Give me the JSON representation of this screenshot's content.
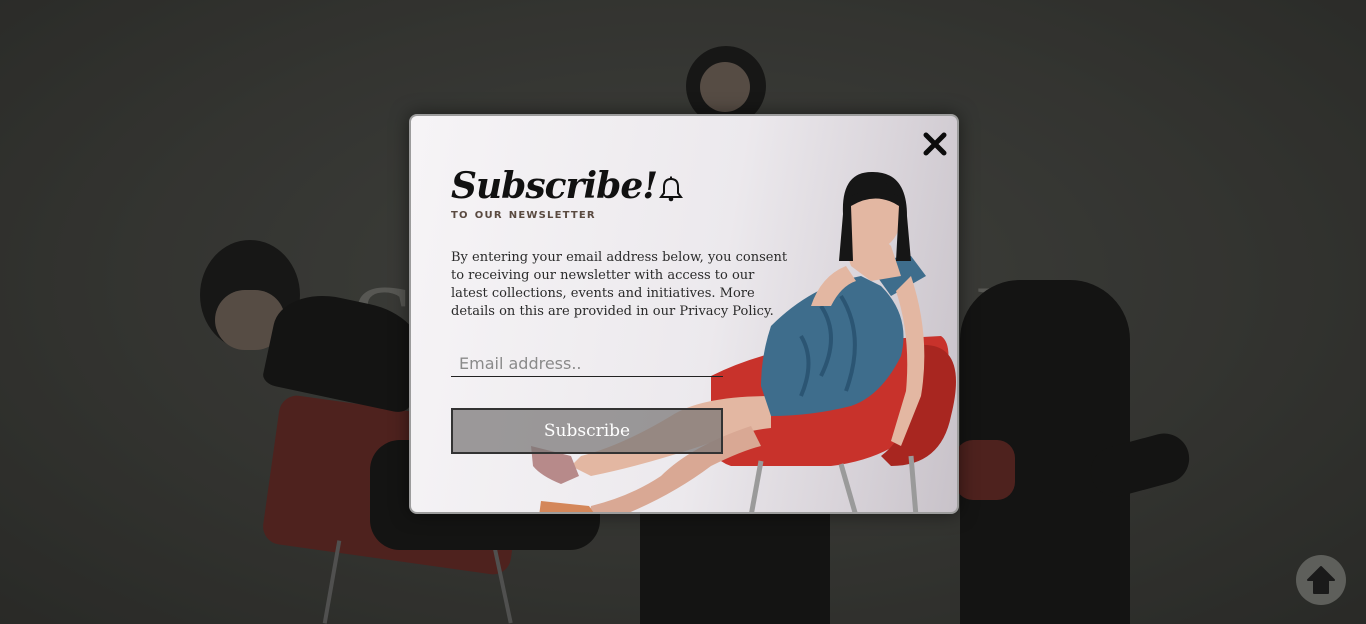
{
  "background": {
    "brand_word_left": "S",
    "brand_word_right": "I"
  },
  "modal": {
    "title": "Subscribe!",
    "subtitle": "to our newsletter",
    "description": "By entering your email address below, you consent to receiving our newsletter with access to our latest collections, events and initiatives. More details on this are provided in our Privacy Policy.",
    "email_placeholder": "Email address..",
    "email_value": "",
    "subscribe_label": "Subscribe",
    "close_icon": "close-icon",
    "bell_icon": "bell-icon"
  },
  "scroll_top": {
    "icon": "arrow-up-icon"
  },
  "colors": {
    "chair_red": "#c8322b",
    "dress_blue": "#3e6d8c",
    "overlay_dark": "#3f403d"
  }
}
